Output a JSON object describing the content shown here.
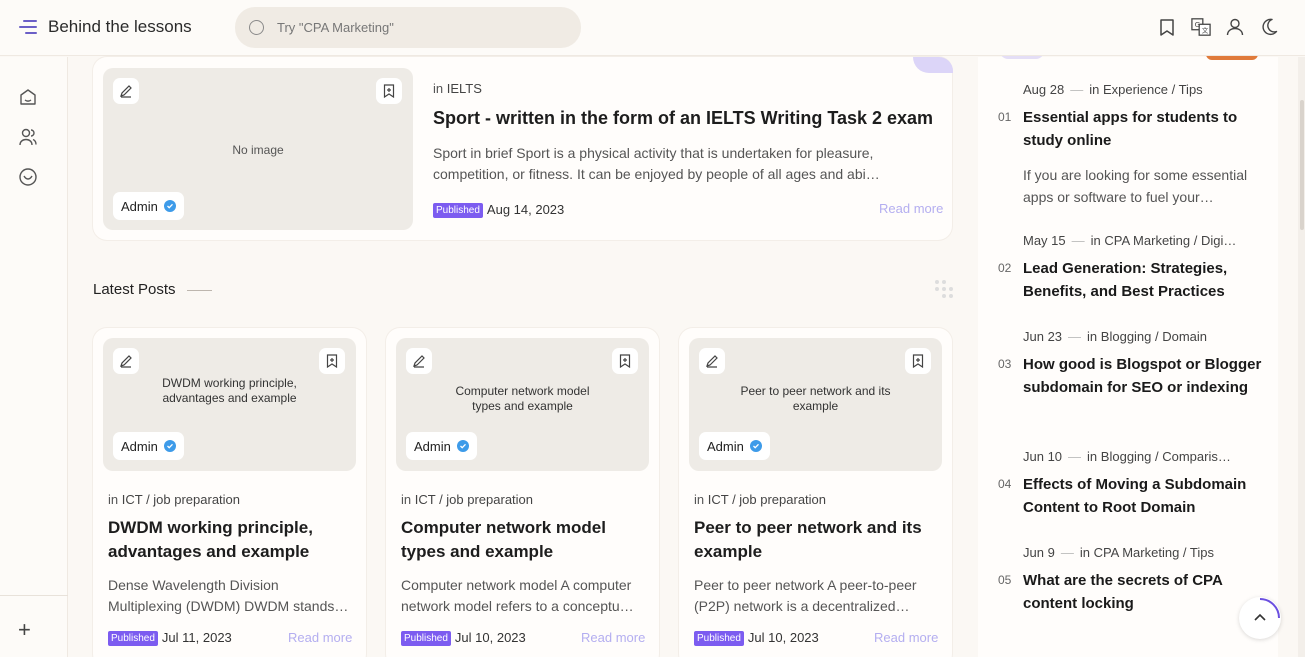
{
  "header": {
    "site_title": "Behind the lessons",
    "search_placeholder": "Try \"CPA Marketing\"",
    "icons": [
      "bookmark-icon",
      "translate-icon",
      "user-icon",
      "moon-icon"
    ]
  },
  "sidebar": {
    "items": [
      "home-icon",
      "users-icon",
      "inbox-icon"
    ],
    "plus_icon": "+"
  },
  "featured": {
    "thumb_text": "No image",
    "author": "Admin",
    "category_prefix": "in",
    "category": "IELTS",
    "title": "Sport - written in the form of an IELTS Writing Task 2 exam",
    "excerpt": "Sport in brief Sport is a physical activity that is undertaken for pleasure, competition, or fitness. It can be enjoyed by people of all ages and abi…",
    "badge": "Published",
    "date": "Aug 14, 2023",
    "read_more": "Read more"
  },
  "latest": {
    "title": "Latest Posts",
    "posts": [
      {
        "thumb_alt": "DWDM working principle, advantages and example",
        "author": "Admin",
        "category_prefix": "in",
        "category": "ICT / job preparation",
        "title": "DWDM working principle, advantages and example",
        "excerpt": "Dense Wavelength Division Multiplexing (DWDM) DWDM stands…",
        "badge": "Published",
        "date": "Jul 11, 2023",
        "read_more": "Read more"
      },
      {
        "thumb_alt": "Computer network model types and example",
        "author": "Admin",
        "category_prefix": "in",
        "category": "ICT / job preparation",
        "title": "Computer network model types and example",
        "excerpt": "Computer network model A computer network model refers to a conceptu…",
        "badge": "Published",
        "date": "Jul 10, 2023",
        "read_more": "Read more"
      },
      {
        "thumb_alt": "Peer to peer network and its example",
        "author": "Admin",
        "category_prefix": "in",
        "category": "ICT / job preparation",
        "title": "Peer to peer network and its example",
        "excerpt": "Peer to peer network A peer-to-peer (P2P) network is a decentralized…",
        "badge": "Published",
        "date": "Jul 10, 2023",
        "read_more": "Read more"
      }
    ]
  },
  "popular": [
    {
      "num": "01",
      "date": "Aug 28",
      "category_prefix": "in",
      "category": "Experience / Tips",
      "title": "Essential apps for students to study online",
      "excerpt": "If you are looking for some essential apps or software to fuel your…"
    },
    {
      "num": "02",
      "date": "May 15",
      "category_prefix": "in",
      "category": "CPA Marketing / Digi…",
      "title": "Lead Generation: Strategies, Benefits, and Best Practices"
    },
    {
      "num": "03",
      "date": "Jun 23",
      "category_prefix": "in",
      "category": "Blogging / Domain",
      "title": "How good is Blogspot or Blogger subdomain for SEO or indexing"
    },
    {
      "num": "04",
      "date": "Jun 10",
      "category_prefix": "in",
      "category": "Blogging / Comparis…",
      "title": "Effects of Moving a Subdomain Content to Root Domain"
    },
    {
      "num": "05",
      "date": "Jun 9",
      "category_prefix": "in",
      "category": "CPA Marketing / Tips",
      "title": "What are the secrets of CPA content locking"
    }
  ],
  "colors": {
    "accent": "#7c5cf0",
    "read_more": "#b4aef0",
    "verified": "#3d9be9"
  }
}
